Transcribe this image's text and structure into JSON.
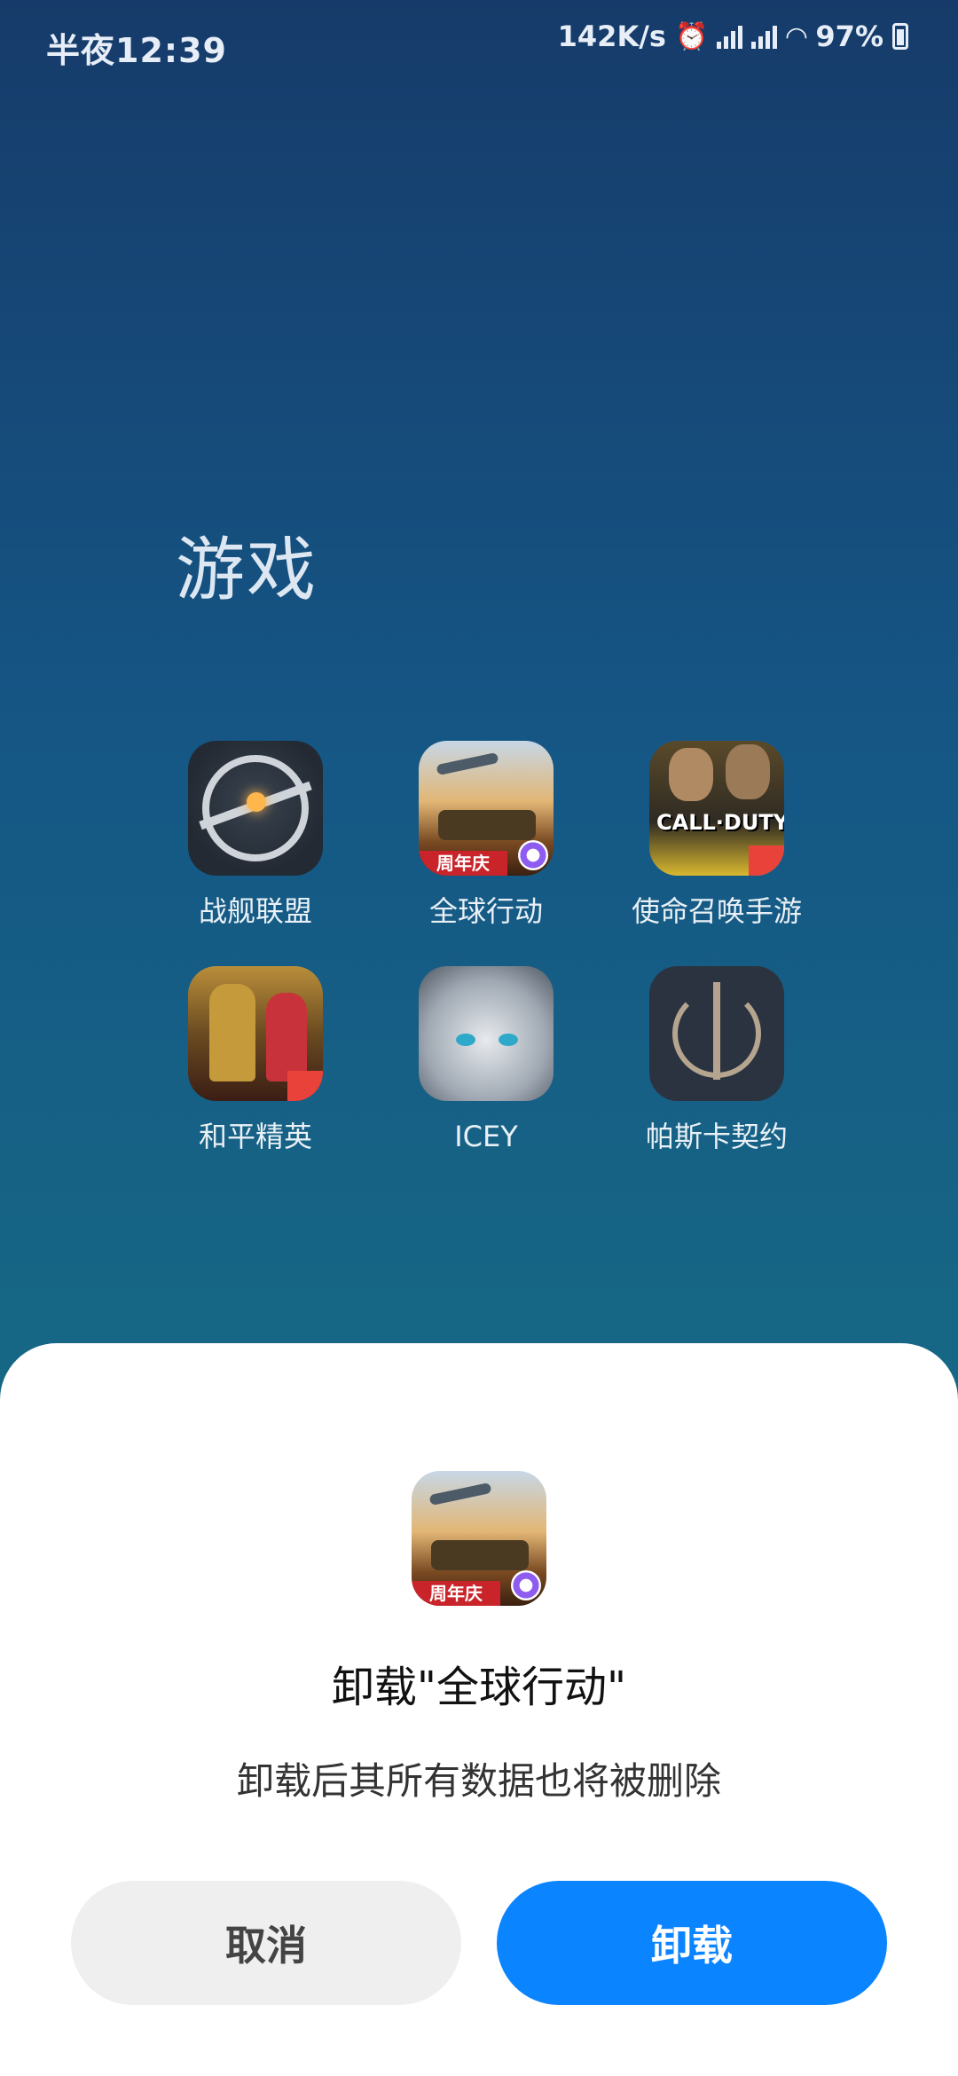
{
  "status_bar": {
    "time": "半夜12:39",
    "net_speed": "142K/s",
    "battery": "97%",
    "icons": [
      "alarm-icon",
      "signal-icon",
      "signal-icon",
      "wifi-icon",
      "battery-icon"
    ]
  },
  "folder": {
    "title": "游戏",
    "apps": [
      {
        "label": "战舰联盟",
        "icon": "warship-alliance-icon"
      },
      {
        "label": "全球行动",
        "icon": "global-action-icon"
      },
      {
        "label": "使命召唤手游",
        "icon": "call-of-duty-icon"
      },
      {
        "label": "和平精英",
        "icon": "peace-elite-icon"
      },
      {
        "label": "ICEY",
        "icon": "icey-icon"
      },
      {
        "label": "帕斯卡契约",
        "icon": "pascal-contract-icon"
      }
    ]
  },
  "dialog": {
    "title": "卸载\"全球行动\"",
    "message": "卸载后其所有数据也将被删除",
    "cancel_label": "取消",
    "uninstall_label": "卸载",
    "accent_color": "#0a84ff"
  },
  "game_icon_text": {
    "global_badge": "周年庆",
    "cod_logo": "CALL·DUTY"
  }
}
